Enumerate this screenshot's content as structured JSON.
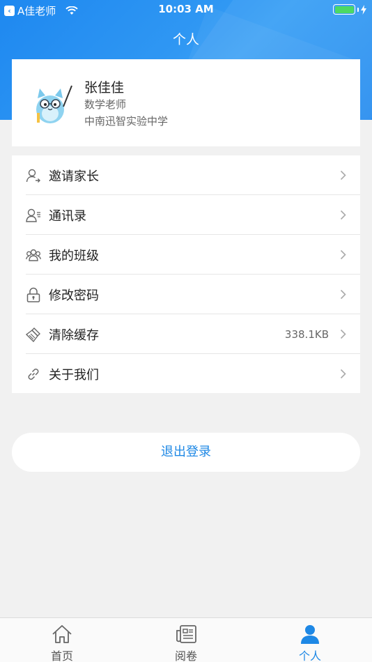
{
  "status_bar": {
    "back_app": "A佳老师",
    "time": "10:03 AM"
  },
  "header": {
    "title": "个人"
  },
  "profile": {
    "name": "张佳佳",
    "role": "数学老师",
    "school": "中南迅智实验中学",
    "avatar_icon": "cartoon-owl-teacher-avatar"
  },
  "menu": {
    "items": [
      {
        "label": "邀请家长",
        "icon": "invite-parent-icon",
        "value": ""
      },
      {
        "label": "通讯录",
        "icon": "contacts-icon",
        "value": ""
      },
      {
        "label": "我的班级",
        "icon": "class-icon",
        "value": ""
      },
      {
        "label": "修改密码",
        "icon": "lock-icon",
        "value": ""
      },
      {
        "label": "清除缓存",
        "icon": "broom-icon",
        "value": "338.1KB"
      },
      {
        "label": "关于我们",
        "icon": "link-icon",
        "value": ""
      }
    ]
  },
  "logout": {
    "label": "退出登录"
  },
  "tabbar": {
    "tabs": [
      {
        "label": "首页",
        "icon": "home-icon",
        "active": false
      },
      {
        "label": "阅卷",
        "icon": "newspaper-icon",
        "active": false
      },
      {
        "label": "个人",
        "icon": "person-icon",
        "active": true
      }
    ]
  },
  "colors": {
    "header_blue": "#2a8ef0",
    "accent": "#1e88e5",
    "battery_green": "#4cd964",
    "background": "#f1f1f1"
  }
}
